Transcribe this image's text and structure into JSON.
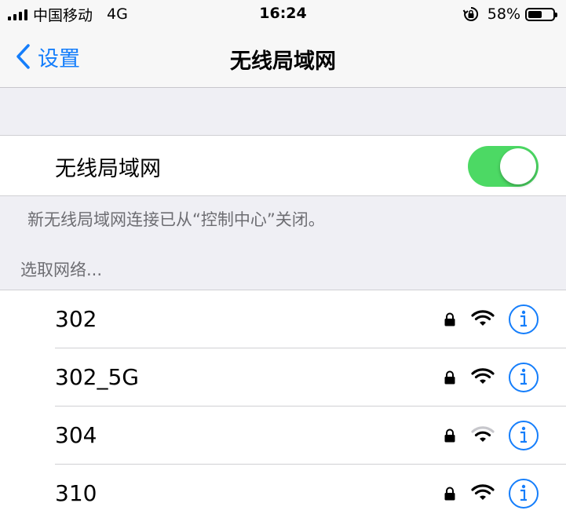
{
  "status_bar": {
    "carrier": "中国移动",
    "network_type": "4G",
    "time": "16:24",
    "battery_percent": "58%",
    "battery_level": 0.58,
    "icons": [
      "signal-icon",
      "rotation-lock-icon",
      "battery-icon"
    ]
  },
  "nav": {
    "back_label": "设置",
    "title": "无线局域网"
  },
  "wifi_toggle": {
    "label": "无线局域网",
    "on": true,
    "on_color": "#4cd964"
  },
  "footer_note": "新无线局域网连接已从“控制中心”关闭。",
  "section_header": "选取网络...",
  "networks": [
    {
      "name": "302",
      "locked": true,
      "signal": "strong"
    },
    {
      "name": "302_5G",
      "locked": true,
      "signal": "strong"
    },
    {
      "name": "304",
      "locked": true,
      "signal": "weak"
    },
    {
      "name": "310",
      "locked": true,
      "signal": "strong"
    }
  ],
  "colors": {
    "accent": "#157efb",
    "background": "#efeff4",
    "secondary_text": "#6d6d72"
  }
}
